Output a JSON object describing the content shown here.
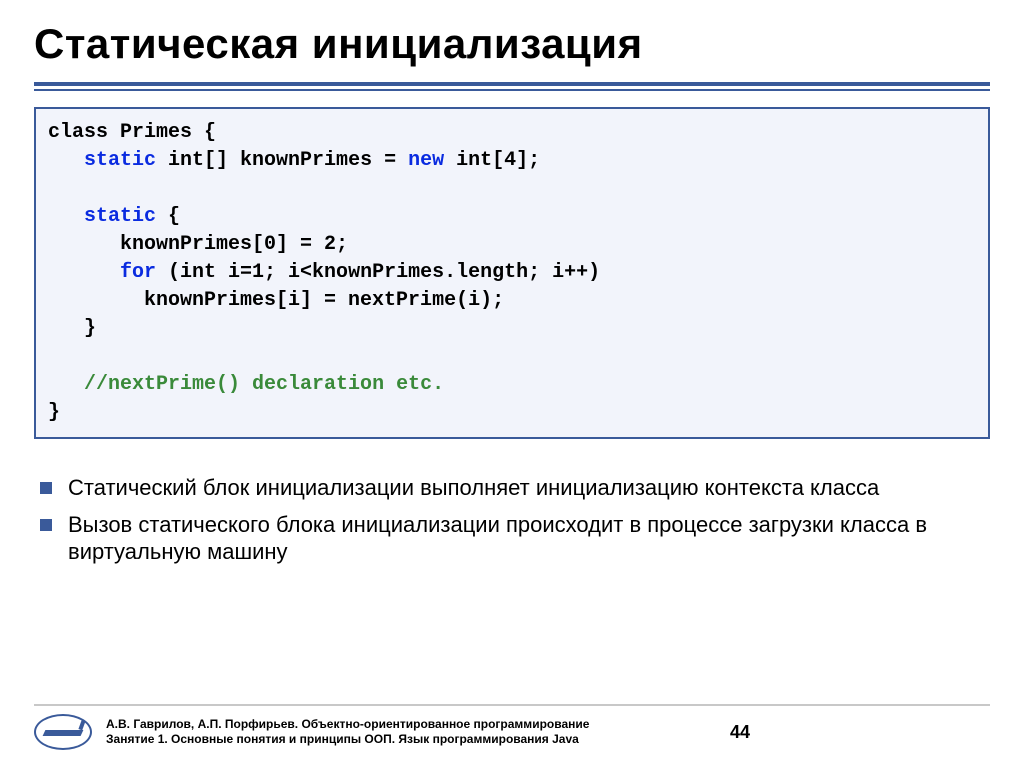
{
  "title": "Статическая инициализация",
  "code": {
    "l1a": "class Primes {",
    "l2a": "   ",
    "l2b": "static",
    "l2c": " int[] knownPrimes = ",
    "l2d": "new",
    "l2e": " int[4];",
    "blank": "",
    "l3a": "   ",
    "l3b": "static",
    "l3c": " {",
    "l4": "      knownPrimes[0] = 2;",
    "l5a": "      ",
    "l5b": "for",
    "l5c": " (int i=1; i<knownPrimes.length; i++)",
    "l6": "        knownPrimes[i] = nextPrime(i);",
    "l7": "   }",
    "l8a": "   ",
    "l8b": "//nextPrime() declaration etc.",
    "l9": "}"
  },
  "bullets": [
    "Статический блок инициализации выполняет инициализацию контекста класса",
    "Вызов статического блока инициализации происходит в процессе загрузки класса в виртуальную машину"
  ],
  "footer": {
    "line1": "А.В. Гаврилов, А.П. Порфирьев. Объектно-ориентированное программирование",
    "line2": "Занятие 1. Основные понятия и принципы ООП. Язык программирования Java",
    "page": "44"
  }
}
